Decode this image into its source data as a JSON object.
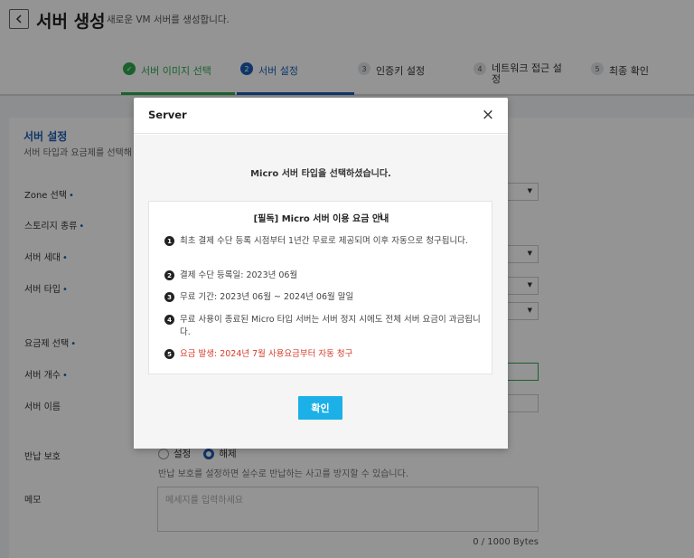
{
  "header": {
    "title": "서버 생성",
    "subtitle": "새로운 VM 서버를 생성합니다."
  },
  "steps": [
    {
      "num": "✓",
      "label": "서버 이미지 선택",
      "state": "done"
    },
    {
      "num": "2",
      "label": "서버 설정",
      "state": "active"
    },
    {
      "num": "3",
      "label": "인증키 설정",
      "state": "todo"
    },
    {
      "num": "4",
      "label": "네트워크 접근 설정",
      "state": "todo"
    },
    {
      "num": "5",
      "label": "최종 확인",
      "state": "todo"
    }
  ],
  "form": {
    "section_title": "서버 설정",
    "section_sub": "서버 타입과 요금제를 선택해",
    "labels": {
      "zone": "Zone 선택",
      "storage": "스토리지 종류",
      "generation": "서버 세대",
      "type": "서버 타입",
      "plan": "요금제 선택",
      "count": "서버 개수",
      "name": "서버 이름",
      "protection": "반납 보호",
      "memo": "메모"
    },
    "protection_options": [
      "설정",
      "해제"
    ],
    "protection_selected": "해제",
    "protection_hint": "반납 보호를 설정하면 실수로 반납하는 사고를 방지할 수 있습니다.",
    "memo_placeholder": "메세지를 입력하세요",
    "memo_counter": "0 / 1000 Bytes"
  },
  "modal": {
    "title": "Server",
    "close_glyph": "×",
    "message": "Micro 서버 타입을 선택하셨습니다.",
    "notice_title": "[필독] Micro 서버 이용 요금 안내",
    "items": [
      {
        "num": "1",
        "text": "최초 결제 수단 등록 시점부터 1년간 무료로 제공되며 이후 자동으로 청구됩니다.",
        "highlight": false
      },
      {
        "num": "2",
        "text": "결제 수단 등록일: 2023년 06월",
        "highlight": false
      },
      {
        "num": "3",
        "text": "무료 기간: 2023년 06월 ~ 2024년 06월 말일",
        "highlight": false
      },
      {
        "num": "4",
        "text": "무료 사용이 종료된 Micro 타입 서버는 서버 정지 시에도 전체 서버 요금이 과금됩니다.",
        "highlight": false
      },
      {
        "num": "5",
        "text": "요금 발생: 2024년 7월 사용요금부터 자동 청구",
        "highlight": true
      }
    ],
    "confirm_label": "확인"
  },
  "colors": {
    "accent_blue": "#1c5db6",
    "done_green": "#2fa84f",
    "confirm_button": "#1bb0e8",
    "warning_red": "#d43c2b"
  }
}
